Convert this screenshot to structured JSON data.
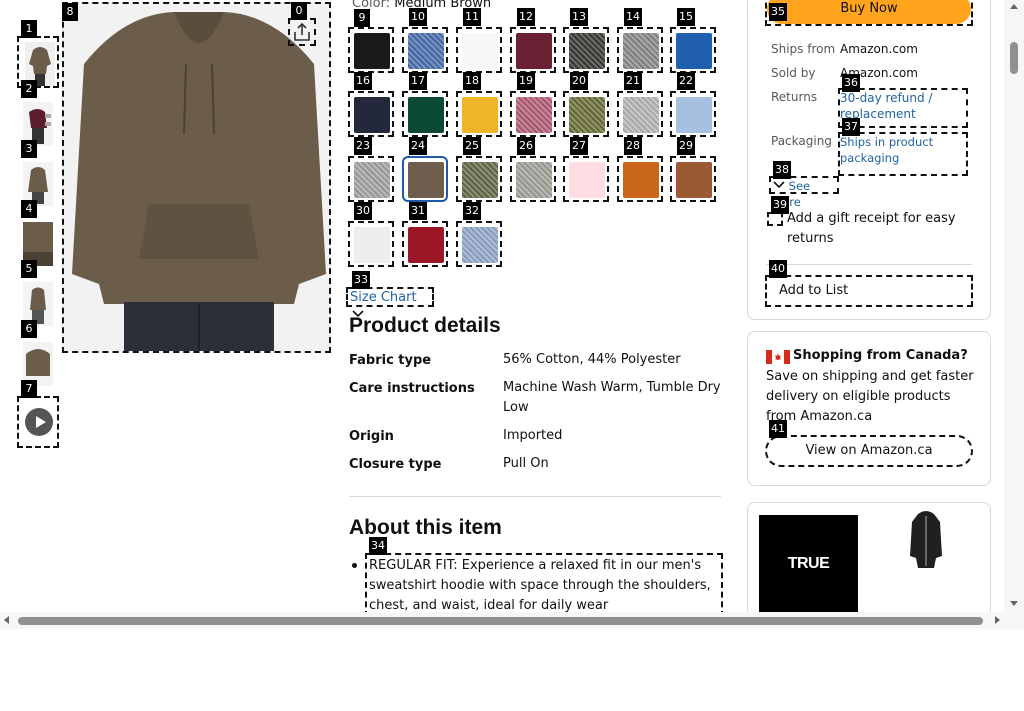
{
  "product": {
    "color_label": "Color:",
    "color_value": "Medium Brown"
  },
  "swatches": [
    {
      "color": "#1a1a1a"
    },
    {
      "color": "#4a6fae"
    },
    {
      "color": "#f7f7f5"
    },
    {
      "color": "#6b1f33"
    },
    {
      "color": "#3a3a36"
    },
    {
      "color": "#8a8a8a"
    },
    {
      "color": "#1f5fae"
    },
    {
      "color": "#24283b"
    },
    {
      "color": "#0c4a36"
    },
    {
      "color": "#f0b429"
    },
    {
      "color": "#b35f76"
    },
    {
      "color": "#6b7038"
    },
    {
      "color": "#b6b6b6"
    },
    {
      "color": "#a7bfe0"
    },
    {
      "color": "#a3a3a3"
    },
    {
      "color": "#6f5d4e"
    },
    {
      "color": "#676b4a"
    },
    {
      "color": "#9fa39a"
    },
    {
      "color": "#ffdde3"
    },
    {
      "color": "#c8671b"
    },
    {
      "color": "#9c5a34"
    },
    {
      "color": "#eeeeec"
    },
    {
      "color": "#9d1628"
    },
    {
      "color": "#93a8c9"
    }
  ],
  "size_chart": {
    "label": "Size Chart"
  },
  "details": {
    "title": "Product details",
    "rows": [
      {
        "label": "Fabric type",
        "value": "56% Cotton, 44% Polyester"
      },
      {
        "label": "Care instructions",
        "value": "Machine Wash Warm, Tumble Dry Low"
      },
      {
        "label": "Origin",
        "value": "Imported"
      },
      {
        "label": "Closure type",
        "value": "Pull On"
      }
    ]
  },
  "about": {
    "title": "About this item",
    "bullet1": "REGULAR FIT: Experience a relaxed fit in our men's sweatshirt hoodie with space through the shoulders, chest, and waist, ideal for daily wear"
  },
  "buy_box": {
    "buy_now": "Buy Now",
    "ships_from_label": "Ships from",
    "ships_from_value": "Amazon.com",
    "sold_by_label": "Sold by",
    "sold_by_value": "Amazon.com",
    "returns_label": "Returns",
    "returns_value": "30-day refund / replacement",
    "packaging_label": "Packaging",
    "packaging_value": "Ships in product packaging",
    "see_more": "See more",
    "gift_receipt": "Add a gift receipt for easy returns",
    "add_to_list": "Add to List"
  },
  "canada": {
    "title": "Shopping from Canada?",
    "body": "Save on shipping and get faster delivery on eligible products from Amazon.ca",
    "button": "View on Amazon.ca"
  },
  "ad": {
    "brand": "TRUE CLASSIC"
  },
  "colors": {
    "link": "#2162a1",
    "buy_now": "#ffa41c",
    "selected_border": "#1e5aa8",
    "hoodie": "#6b5d49",
    "canada_flag_red": "#d52b1e"
  },
  "markers": [
    "0",
    "1",
    "2",
    "3",
    "4",
    "5",
    "6",
    "7",
    "8",
    "9",
    "10",
    "11",
    "12",
    "13",
    "14",
    "15",
    "16",
    "17",
    "18",
    "19",
    "20",
    "21",
    "22",
    "23",
    "24",
    "25",
    "26",
    "27",
    "28",
    "29",
    "30",
    "31",
    "32",
    "33",
    "34",
    "35",
    "36",
    "37",
    "38",
    "39",
    "40",
    "41"
  ]
}
